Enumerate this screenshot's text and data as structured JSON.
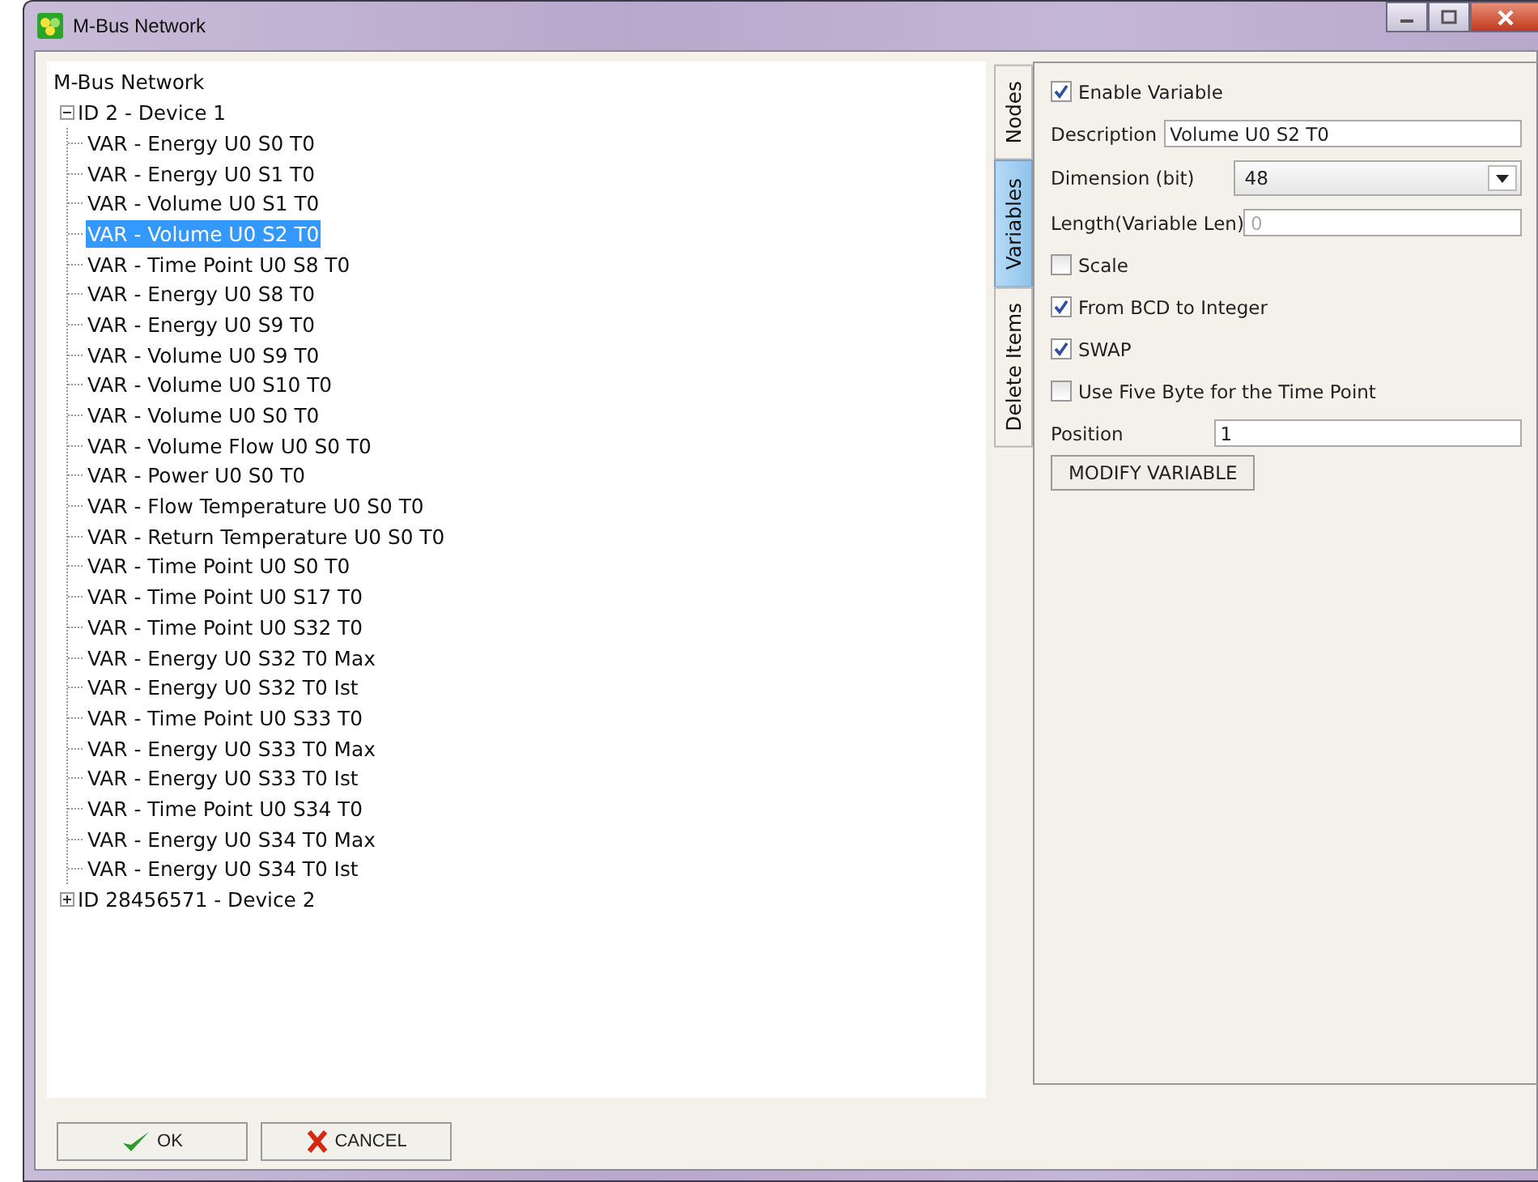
{
  "window": {
    "title": "M-Bus Network"
  },
  "tree": {
    "label": "M-Bus Network",
    "children": [
      {
        "label": "ID 2 - Device 1",
        "expanded": true,
        "children": [
          {
            "label": "VAR - Energy U0 S0 T0",
            "selected": false
          },
          {
            "label": "VAR - Energy U0 S1 T0",
            "selected": false
          },
          {
            "label": "VAR - Volume U0 S1 T0",
            "selected": false
          },
          {
            "label": "VAR - Volume U0 S2 T0",
            "selected": true
          },
          {
            "label": "VAR - Time Point U0 S8 T0",
            "selected": false
          },
          {
            "label": "VAR - Energy U0 S8 T0",
            "selected": false
          },
          {
            "label": "VAR - Energy U0 S9 T0",
            "selected": false
          },
          {
            "label": "VAR - Volume U0 S9 T0",
            "selected": false
          },
          {
            "label": "VAR - Volume U0 S10 T0",
            "selected": false
          },
          {
            "label": "VAR - Volume U0 S0 T0",
            "selected": false
          },
          {
            "label": "VAR - Volume Flow U0 S0 T0",
            "selected": false
          },
          {
            "label": "VAR - Power U0 S0 T0",
            "selected": false
          },
          {
            "label": "VAR - Flow Temperature U0 S0 T0",
            "selected": false
          },
          {
            "label": "VAR - Return Temperature U0 S0 T0",
            "selected": false
          },
          {
            "label": "VAR - Time Point U0 S0 T0",
            "selected": false
          },
          {
            "label": "VAR - Time Point U0 S17 T0",
            "selected": false
          },
          {
            "label": "VAR - Time Point U0 S32 T0",
            "selected": false
          },
          {
            "label": "VAR - Energy U0 S32 T0 Max",
            "selected": false
          },
          {
            "label": "VAR - Energy U0 S32 T0 Ist",
            "selected": false
          },
          {
            "label": "VAR - Time Point U0 S33 T0",
            "selected": false
          },
          {
            "label": "VAR - Energy U0 S33 T0 Max",
            "selected": false
          },
          {
            "label": "VAR - Energy U0 S33 T0 Ist",
            "selected": false
          },
          {
            "label": "VAR - Time Point U0 S34 T0",
            "selected": false
          },
          {
            "label": "VAR - Energy U0 S34 T0 Max",
            "selected": false
          },
          {
            "label": "VAR - Energy U0 S34 T0 Ist",
            "selected": false
          }
        ]
      },
      {
        "label": "ID 28456571 - Device 2",
        "expanded": false
      }
    ]
  },
  "tabs": [
    {
      "label": "Nodes",
      "selected": false
    },
    {
      "label": "Variables",
      "selected": true
    },
    {
      "label": "Delete Items",
      "selected": false
    }
  ],
  "form": [
    {
      "kind": "checkbox",
      "label": "Enable Variable",
      "checked": true
    },
    {
      "kind": "text",
      "label": "Description",
      "value": "Volume U0 S2 T0",
      "disabled": false
    },
    {
      "kind": "select",
      "label": "Dimension (bit)",
      "value": "48"
    },
    {
      "kind": "text",
      "label": "Length(Variable Len)",
      "value": "0",
      "disabled": true
    },
    {
      "kind": "checkbox",
      "label": "Scale",
      "checked": false
    },
    {
      "kind": "checkbox",
      "label": "From BCD to Integer",
      "checked": true
    },
    {
      "kind": "checkbox",
      "label": "SWAP",
      "checked": true
    },
    {
      "kind": "checkbox",
      "label": "Use Five Byte for the Time Point",
      "checked": false
    },
    {
      "kind": "text",
      "label": "Position",
      "value": "1",
      "disabled": false
    },
    {
      "kind": "button",
      "label": "MODIFY VARIABLE"
    }
  ],
  "buttons": [
    {
      "kind": "ok",
      "label": "OK"
    },
    {
      "kind": "cancel",
      "label": "CANCEL"
    }
  ]
}
